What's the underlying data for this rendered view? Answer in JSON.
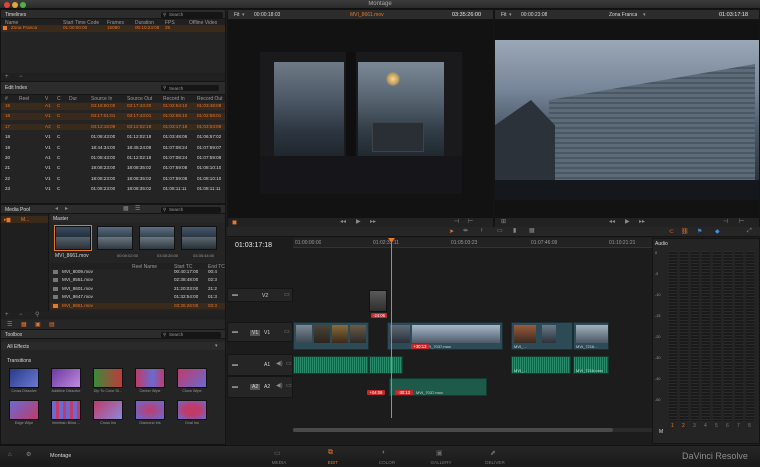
{
  "app": {
    "window_title": "Montage",
    "project": "Montage",
    "brand": "DaVinci Resolve"
  },
  "timelines": {
    "title": "Timelines",
    "search_placeholder": "Search",
    "columns": [
      "Name",
      "Start Time Code",
      "Frames",
      "Duration",
      "FPS",
      "Offline Video"
    ],
    "rows": [
      [
        "Zona Franca",
        "01:00:00:00",
        "15080",
        "00:10:23:08",
        "25",
        ""
      ]
    ]
  },
  "edit_index": {
    "title": "Edit Index",
    "search_placeholder": "Search",
    "columns": [
      "#",
      "Reel",
      "V",
      "C",
      "Dur",
      "Source In",
      "Source Out",
      "Record In",
      "Record Out"
    ],
    "rows": [
      [
        "15",
        "",
        "A1",
        "C",
        "",
        "03:18:50:00",
        "03:17:43:20",
        "01:02:54:10",
        "01:03:48:08"
      ],
      [
        "16",
        "",
        "V1",
        "C",
        "",
        "03:17:01:01",
        "03:17:43:01",
        "01:02:55:10",
        "01:02:58:01"
      ],
      [
        "17",
        "",
        "A2",
        "C",
        "",
        "03:12:16:09",
        "03:12:02:18",
        "01:03:17:18",
        "01:03:04:06"
      ],
      [
        "18",
        "",
        "V1",
        "C",
        "",
        "01:08:43:00",
        "01:12:02:18",
        "01:03:48:06",
        "01:06:57:02"
      ],
      [
        "19",
        "",
        "V1",
        "C",
        "",
        "18:44:34:00",
        "18:45:24:08",
        "01:07:08:24",
        "01:07:59:07"
      ],
      [
        "20",
        "",
        "A1",
        "C",
        "",
        "01:08:43:00",
        "01:12:02:18",
        "01:07:08:24",
        "01:07:59:08"
      ],
      [
        "21",
        "",
        "V1",
        "C",
        "",
        "18:08:23:00",
        "18:08:35:02",
        "01:07:59:08",
        "01:08:10:10"
      ],
      [
        "22",
        "",
        "V1",
        "C",
        "",
        "18:08:23:00",
        "18:08:35:02",
        "01:07:59:08",
        "01:08:10:10"
      ],
      [
        "23",
        "",
        "V1",
        "C",
        "",
        "01:08:23:00",
        "18:08:35:02",
        "01:08:11:11",
        "01:08:11:11"
      ]
    ]
  },
  "media_pool": {
    "title": "Media Pool",
    "search_placeholder": "Search",
    "bin_label": "M...",
    "master_label": "Master",
    "preview_clip": "MVI_8661.mov",
    "preview_tcs": [
      "00:00:02:00",
      "03:35:26:00",
      "03:35:44:00"
    ],
    "columns": [
      "Reel Name",
      "Start TC",
      "End TC"
    ],
    "rows": [
      [
        "MVI_8009.mov",
        "",
        "00:40:17:00",
        "00:4"
      ],
      [
        "MVI_8551.mov",
        "",
        "02:38:48:00",
        "02:3"
      ],
      [
        "MVI_8601.mov",
        "",
        "21:20:03:00",
        "21:2"
      ],
      [
        "MVI_8647.mov",
        "",
        "01:32:54:00",
        "01:3"
      ],
      [
        "MVI_8661.mov",
        "",
        "03:35:26:00",
        "03:3"
      ]
    ]
  },
  "toolbox": {
    "title": "Toolbox",
    "search_placeholder": "Search",
    "all_effects": "All Effects",
    "transitions_label": "Transitions",
    "tiles": [
      "Cross Dissolve",
      "Additive Dissolve",
      "Dip To Color Di...",
      "Center Wipe",
      "Clock Wipe",
      "Edge Wipe",
      "Venetian Blind ...",
      "Cross Iris",
      "Diamond Iris",
      "Oval Iris"
    ]
  },
  "source_viewer": {
    "fit": "Fit",
    "tc_left": "00:00:18:03",
    "clip": "MVI_8661.mov",
    "tc_right": "03:35:26:00"
  },
  "record_viewer": {
    "fit": "Fit",
    "tc_left": "00:00:23:08",
    "timeline": "Zona Franca",
    "tc_right": "01:03:17:18"
  },
  "timeline": {
    "current_tc": "01:03:17:18",
    "ruler": [
      "01:00:00:00",
      "01:02:31:11",
      "01:05:03:23",
      "01:07:46:09",
      "01:10:21:21"
    ],
    "tracks": [
      "V2",
      "V1",
      "A1",
      "A2"
    ],
    "badges": {
      "v2": "-24:06",
      "v1": "+30:13",
      "a2a": "+04:06",
      "a2b": "-30:13"
    },
    "clip_names": {
      "v1": "MVI_7037.mov",
      "a2": "MVI_7037.mov",
      "v1b": "MVI_...",
      "v1c": "MVI_7216...",
      "a1b": "MVI_...",
      "a1c": "MVI_7216.mov"
    },
    "audio_title": "Audio",
    "meter_ticks": [
      "0",
      "-5",
      "-10",
      "-15",
      "-20",
      "-30",
      "-40",
      "-50"
    ],
    "meter_channels": [
      "1",
      "2",
      "3",
      "4",
      "5",
      "6",
      "7",
      "8"
    ],
    "master_label": "M"
  },
  "pages": [
    "MEDIA",
    "EDIT",
    "COLOR",
    "GALLERY",
    "DELIVER"
  ],
  "active_page": "EDIT",
  "colors": {
    "accent": "#e8762b",
    "panel": "#242424",
    "video_clip": "#2d4b56",
    "audio_clip": "#1d5a4a",
    "badge": "#c3282b"
  }
}
